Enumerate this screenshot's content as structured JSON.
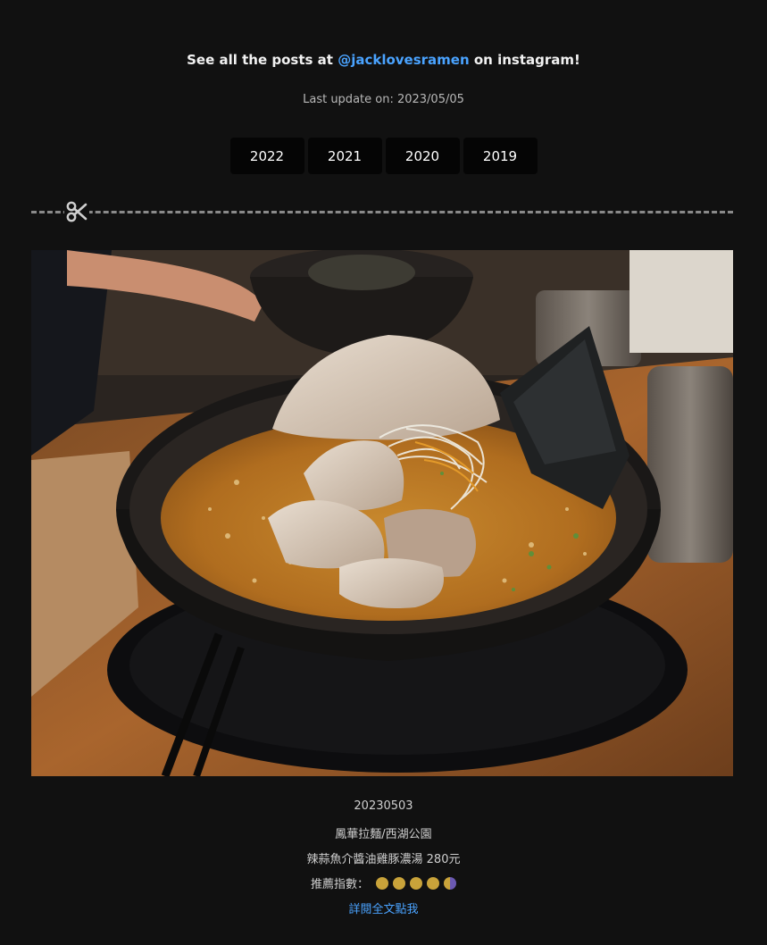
{
  "header": {
    "prefix": "See all the posts at ",
    "handle": "@jacklovesramen",
    "suffix": " on instagram!",
    "last_update": "Last update on: 2023/05/05"
  },
  "year_tabs": [
    "2022",
    "2021",
    "2020",
    "2019"
  ],
  "post": {
    "date": "20230503",
    "shop": "鳳華拉麵/西湖公園",
    "dish": "辣蒜魚介醬油雞豚濃湯 280元",
    "rating_label": "推薦指數：",
    "rating_value": 4.5,
    "rating_max": 5,
    "read_more": "詳閱全文點我"
  },
  "colors": {
    "background": "#111111",
    "link": "#4aa3ff",
    "rating_fill": "#c9a33a",
    "rating_half": "#6b59b3"
  }
}
